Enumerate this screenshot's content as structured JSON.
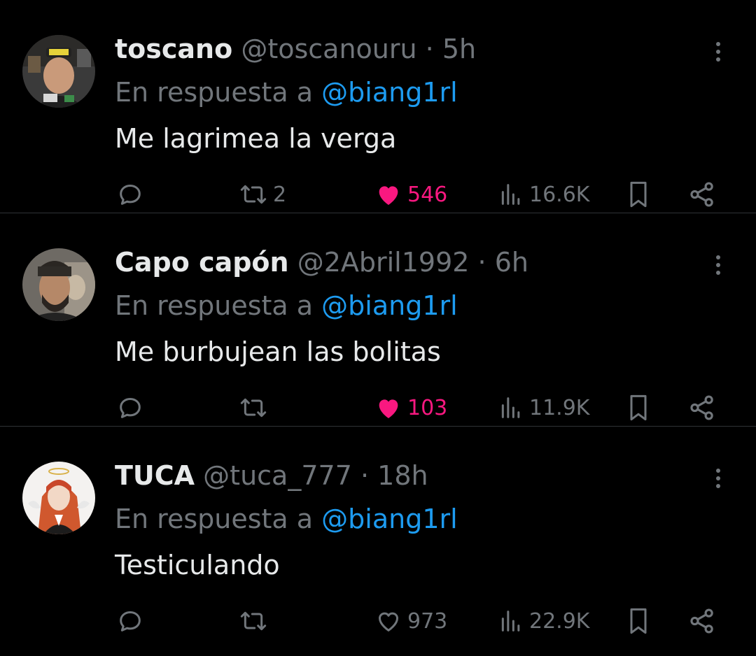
{
  "colors": {
    "background": "#000000",
    "primary_text": "#e7e9ea",
    "secondary_text": "#71767b",
    "link": "#1d9bf0",
    "like_active": "#f91880",
    "divider": "#2f3336"
  },
  "icons": {
    "reply": "speech-bubble-icon",
    "retweet": "retweet-arrows-icon",
    "like": "heart-icon",
    "views": "bar-chart-icon",
    "bookmark": "bookmark-icon",
    "share": "share-nodes-icon",
    "more": "vertical-ellipsis-icon"
  },
  "tweets": [
    {
      "name": "toscano",
      "handle": "@toscanouru",
      "separator": "·",
      "time": "5h",
      "reply_prefix": "En respuesta a",
      "reply_to": "@biang1rl",
      "text": "Me lagrimea la verga",
      "retweets": "2",
      "likes": "546",
      "liked": true,
      "views": "16.6K"
    },
    {
      "name": "Capo capón",
      "handle": "@2Abril1992",
      "separator": "·",
      "time": "6h",
      "reply_prefix": "En respuesta a",
      "reply_to": "@biang1rl",
      "text": "Me burbujean las bolitas",
      "retweets": "",
      "likes": "103",
      "liked": true,
      "views": "11.9K"
    },
    {
      "name": "TUCA",
      "handle": "@tuca_777",
      "separator": "·",
      "time": "18h",
      "reply_prefix": "En respuesta a",
      "reply_to": "@biang1rl",
      "text": "Testiculando",
      "retweets": "",
      "likes": "973",
      "liked": false,
      "views": "22.9K"
    }
  ]
}
